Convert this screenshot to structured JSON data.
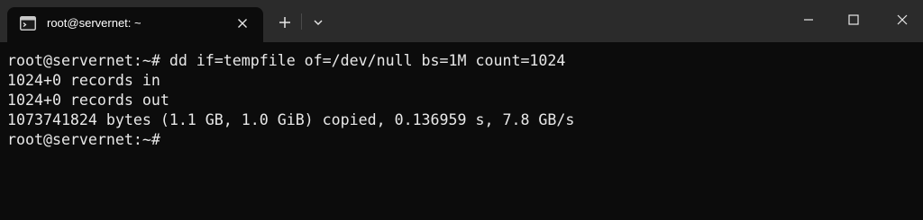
{
  "tab": {
    "title": "root@servernet: ~"
  },
  "terminal": {
    "lines": [
      "root@servernet:~# dd if=tempfile of=/dev/null bs=1M count=1024",
      "1024+0 records in",
      "1024+0 records out",
      "1073741824 bytes (1.1 GB, 1.0 GiB) copied, 0.136959 s, 7.8 GB/s",
      "root@servernet:~#"
    ]
  },
  "icons": {
    "tab": "terminal-icon",
    "close_tab": "close-icon",
    "new_tab": "plus-icon",
    "dropdown": "chevron-down-icon",
    "minimize": "minimize-icon",
    "maximize": "maximize-icon",
    "close_window": "close-icon"
  },
  "colors": {
    "background": "#0c0c0c",
    "titlebar": "#2b2b2b",
    "text": "#e8e8e8"
  }
}
